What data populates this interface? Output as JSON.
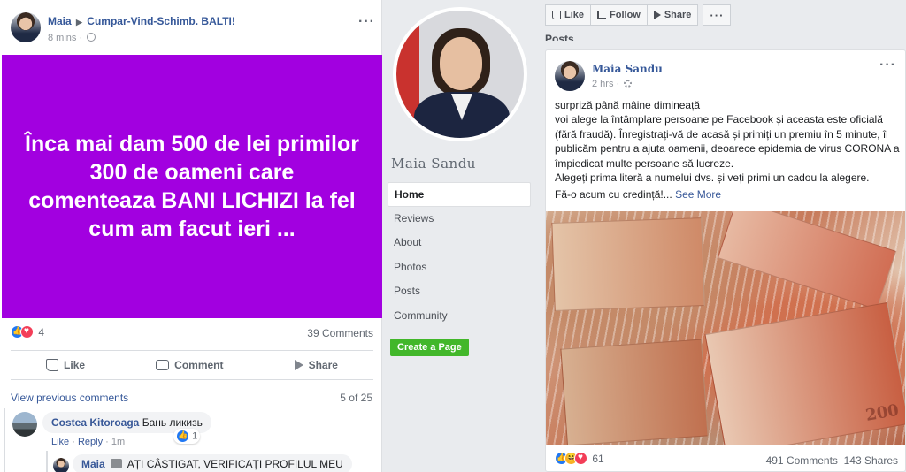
{
  "left_post": {
    "author": "Maia",
    "group": "Cumpar-Vind-Schimb. BALTI!",
    "time": "8 mins",
    "image_text": "Înca mai dam 500 de lei primilor 300 de oameni care comenteaza BANI LICHIZI la fel cum am facut ieri ...",
    "image_bg": "#a200e0",
    "reaction_count": "4",
    "comments_count": "39 Comments",
    "actions": {
      "like": "Like",
      "comment": "Comment",
      "share": "Share"
    },
    "view_previous": "View previous comments",
    "pager": "5 of 25",
    "comment1": {
      "author": "Costea Kitoroaga",
      "text": "Бань ликизь",
      "like": "Like",
      "reply": "Reply",
      "time": "1m",
      "reactions": "1"
    },
    "comment2": {
      "author": "Maia",
      "text": "AȚI CÂȘTIGAT, VERIFICAȚI PROFILUL MEU"
    }
  },
  "profile": {
    "name": "Maia Sandu",
    "nav": [
      "Home",
      "Reviews",
      "About",
      "Photos",
      "Posts",
      "Community"
    ],
    "create_page": "Create a Page"
  },
  "right": {
    "topbar": {
      "like": "Like",
      "follow": "Follow",
      "share": "Share",
      "more": "···"
    },
    "posts_label": "Posts",
    "post": {
      "author": "Maia Sandu",
      "time": "2 hrs",
      "lines": [
        "surpriză până mâine dimineață",
        "voi alege la întâmplare persoane pe Facebook și aceasta este oficială (fără fraudă). Înregistrați-vă de acasă și primiți un premiu în 5 minute, îl publicăm pentru a ajuta oamenii, deoarece epidemia de virus CORONA a împiedicat multe persoane să lucreze.",
        "Alegeți prima literă a numelui dvs. și veți primi un cadou la alegere."
      ],
      "last_line": "Fă-o acum cu credință!...",
      "see_more": "See More",
      "bill_value": "200",
      "reaction_count": "61",
      "comments": "491 Comments",
      "shares": "143 Shares"
    }
  },
  "colors": {
    "link": "#365899",
    "green": "#42b72a",
    "like_blue": "#2078f4"
  }
}
